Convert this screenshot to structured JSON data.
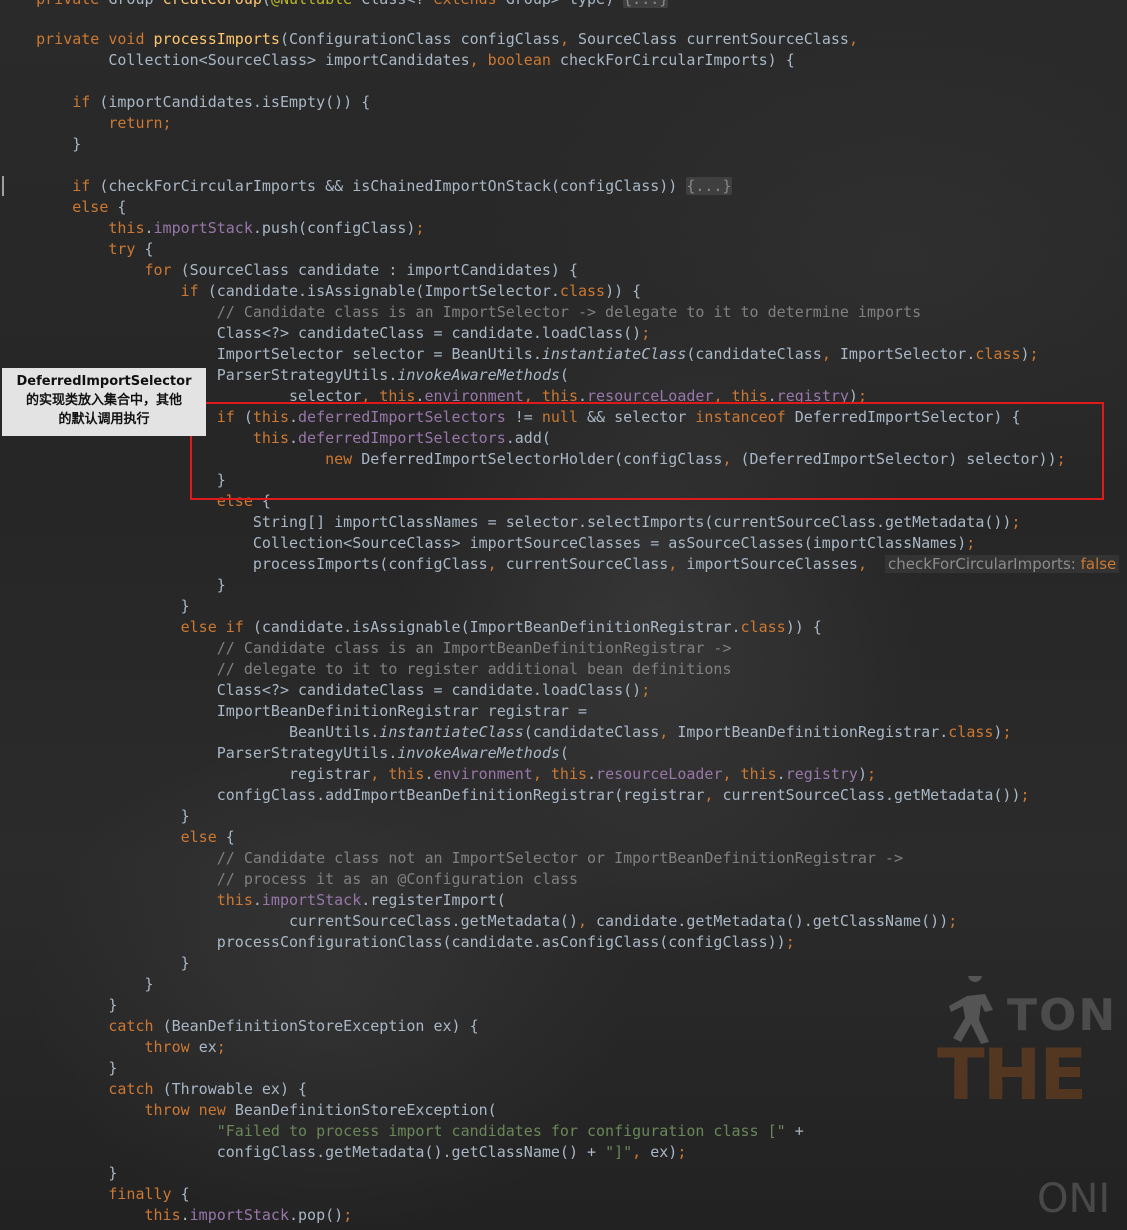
{
  "annotation": {
    "line1": "DeferredImportSelector",
    "line2": "的实现类放入集合中，其他",
    "line3": "的默认调用执行"
  },
  "hint": {
    "check_param": "checkForCircularImports:"
  },
  "watermark": {
    "text_top": "TON",
    "text_mid": "THE",
    "text_bottom": "ONI"
  },
  "colors": {
    "keyword": "#cc7832",
    "method_decl": "#ffc66d",
    "field": "#9876aa",
    "comment": "#808080",
    "string": "#6a8759",
    "text": "#a9b7c6",
    "highlight_border": "#e0191b"
  }
}
